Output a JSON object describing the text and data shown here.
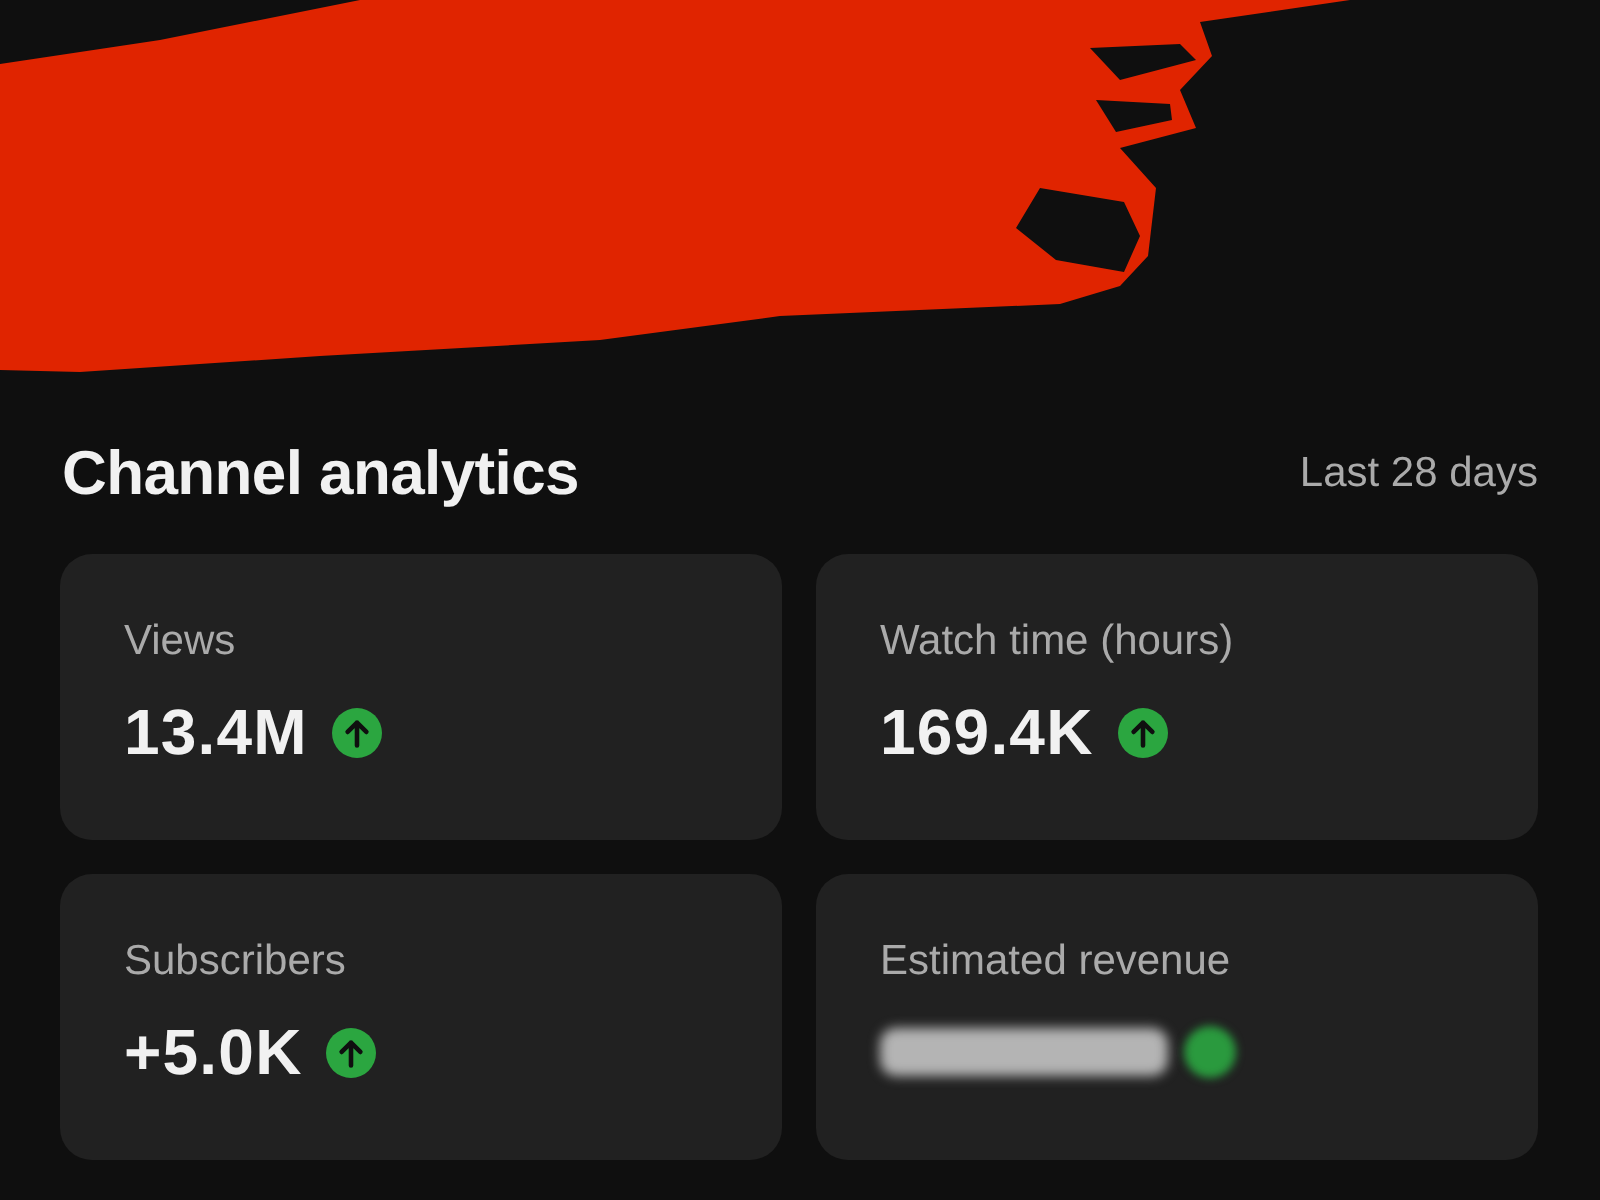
{
  "header": {
    "title": "Channel analytics",
    "period": "Last 28 days"
  },
  "cards": [
    {
      "label": "Views",
      "value": "13.4M",
      "rising": true,
      "blurred": false
    },
    {
      "label": "Watch time (hours)",
      "value": "169.4K",
      "rising": true,
      "blurred": false
    },
    {
      "label": "Subscribers",
      "value": "+5.0K",
      "rising": true,
      "blurred": false
    },
    {
      "label": "Estimated revenue",
      "blurred": true
    }
  ]
}
